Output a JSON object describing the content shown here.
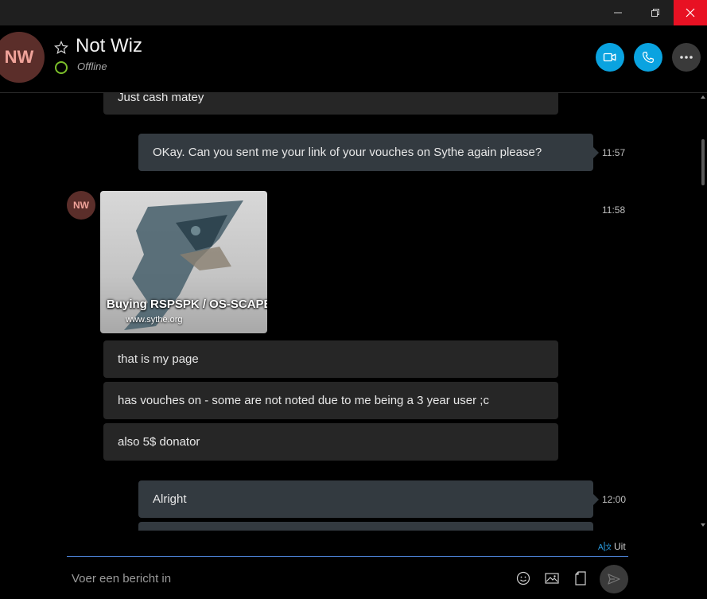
{
  "window": {
    "minimize_icon": "minimize-icon",
    "maximize_icon": "restore-icon",
    "close_icon": "close-icon",
    "close_color": "#e81123"
  },
  "header": {
    "avatar_initials": "NW",
    "contact_name": "Not Wiz",
    "status": "Offline",
    "status_color": "#7bbf2a",
    "accent_color": "#0aa3e0"
  },
  "messages": [
    {
      "direction": "in",
      "text": "Just cash matey"
    },
    {
      "direction": "out",
      "text": "OKay. Can you sent me your link of your vouches on Sythe again please?",
      "time": "11:57"
    },
    {
      "direction": "in",
      "type": "link",
      "avatar": "NW",
      "title": "Buying RSPSPK / OS-SCAPE",
      "url": "www.sythe.org",
      "time": "11:58"
    },
    {
      "direction": "in",
      "text": "that is my page"
    },
    {
      "direction": "in",
      "text": "has vouches on - some are not noted due to me being a 3 year user ;c"
    },
    {
      "direction": "in",
      "text": "also 5$ donator"
    },
    {
      "direction": "out",
      "text": "Alright",
      "time": "12:00"
    }
  ],
  "translate": {
    "label": "Uit"
  },
  "composer": {
    "placeholder": "Voer een bericht in"
  }
}
